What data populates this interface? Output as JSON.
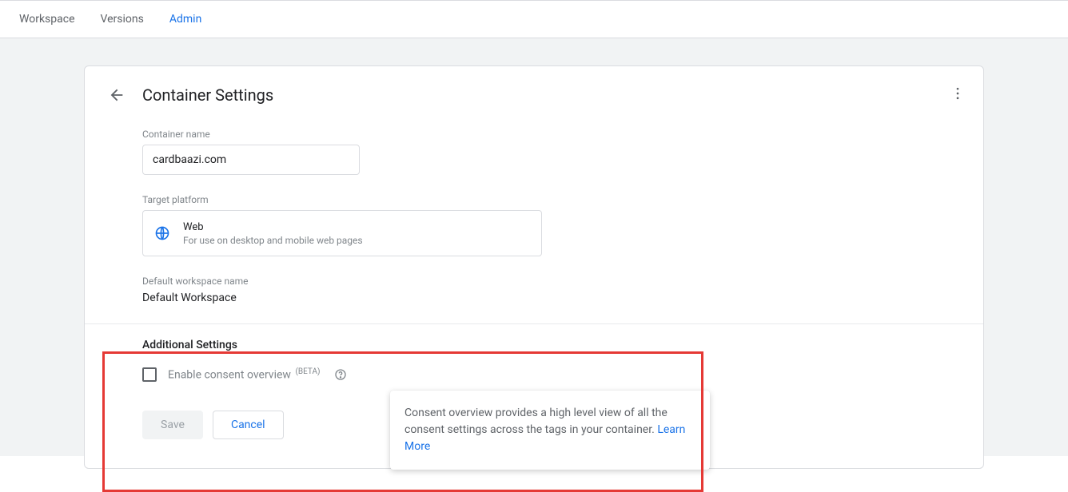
{
  "topNav": {
    "workspace": "Workspace",
    "versions": "Versions",
    "admin": "Admin"
  },
  "header": {
    "title": "Container Settings"
  },
  "container": {
    "nameLabel": "Container name",
    "nameValue": "cardbaazi.com"
  },
  "platform": {
    "label": "Target platform",
    "title": "Web",
    "subtitle": "For use on desktop and mobile web pages"
  },
  "workspace": {
    "label": "Default workspace name",
    "value": "Default Workspace"
  },
  "additional": {
    "heading": "Additional Settings",
    "consentLabel": "Enable consent overview",
    "betaTag": "(BETA)"
  },
  "tooltip": {
    "text": "Consent overview provides a high level view of all the consent settings across the tags in your container. ",
    "linkText": "Learn More"
  },
  "buttons": {
    "save": "Save",
    "cancel": "Cancel"
  }
}
